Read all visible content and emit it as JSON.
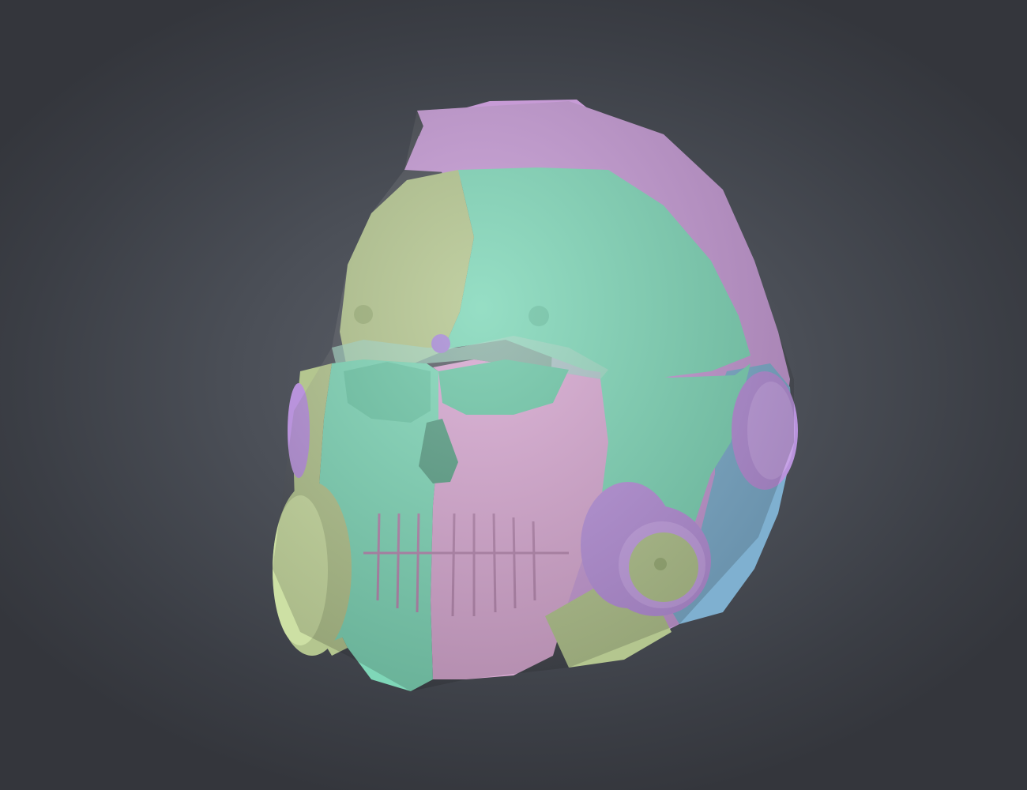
{
  "scene": {
    "subject": "sculpted-helmet-skull-respirator",
    "background_color": "#3a3d44",
    "polygroup_colors": {
      "lilac": "#c79bd6",
      "mint": "#7fd7b8",
      "olive": "#b4c68f",
      "pink": "#d8a9d2",
      "sky": "#7fb0d0",
      "violet": "#b993dc",
      "pale_green": "#cde0a4"
    }
  }
}
